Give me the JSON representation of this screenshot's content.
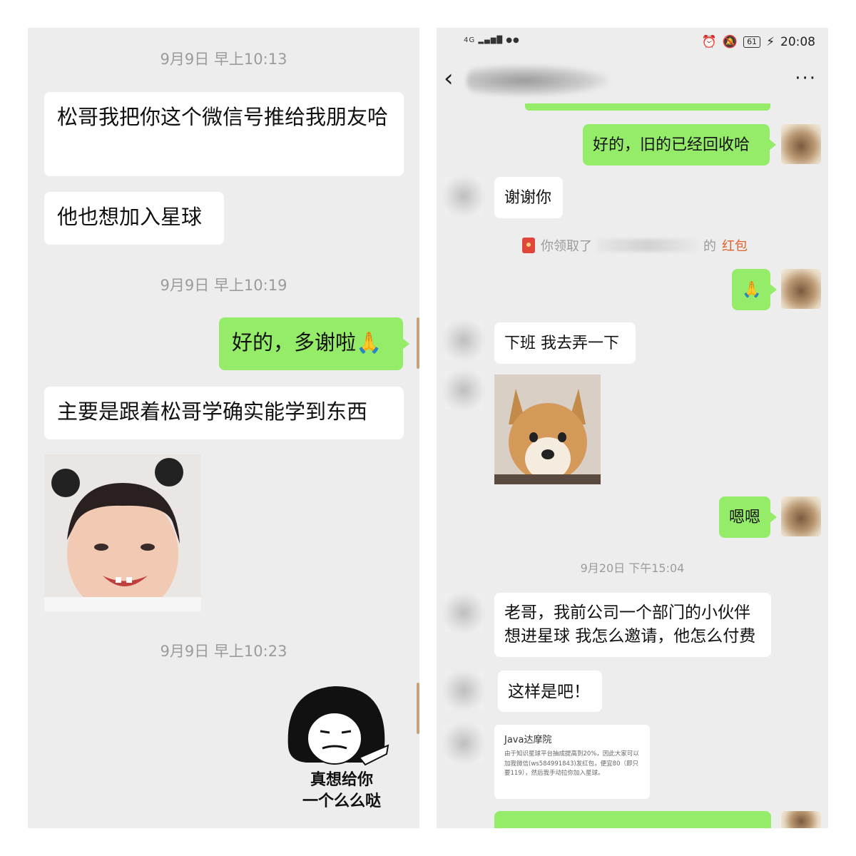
{
  "left": {
    "messages": [
      {
        "type": "time",
        "text": "9月9日 早上10:13"
      },
      {
        "type": "in",
        "text": "松哥我把你这个微信号推给我朋友哈"
      },
      {
        "type": "in",
        "text": "他也想加入星球"
      },
      {
        "type": "time",
        "text": "9月9日 早上10:19"
      },
      {
        "type": "out",
        "text": "好的，多谢啦🙏"
      },
      {
        "type": "in",
        "text": "主要是跟着松哥学确实能学到东西"
      },
      {
        "type": "time",
        "text": "9月9日 早上10:23"
      }
    ],
    "sticker_caption_line1": "真想给你",
    "sticker_caption_line2": "一个么么哒"
  },
  "right": {
    "status": {
      "network": "4G",
      "time": "20:08",
      "battery": "61"
    },
    "more_label": "···",
    "messages": [
      {
        "type": "out",
        "text": "好的，旧的已经回收哈"
      },
      {
        "type": "in",
        "text": "谢谢你"
      },
      {
        "type": "out",
        "text": "🙏"
      },
      {
        "type": "in",
        "text": "下班 我去弄一下"
      },
      {
        "type": "out",
        "text": "嗯嗯"
      },
      {
        "type": "time",
        "text": "9月20日 下午15:04"
      },
      {
        "type": "in",
        "text": "老哥，我前公司一个部门的小伙伴想进星球 我怎么邀请，他怎么付费"
      },
      {
        "type": "in",
        "text": "这样是吧！"
      }
    ],
    "redpacket": {
      "prefix": "你领取了",
      "suffix": "的",
      "link": "红包"
    },
    "card": {
      "title": "Java达摩院",
      "body": "由于知识星球平台抽成提高到20%，因此大家可以加我微信(ws584991843)发红包，便宜80（即只要119），然后我手动拉你加入星球。"
    }
  }
}
